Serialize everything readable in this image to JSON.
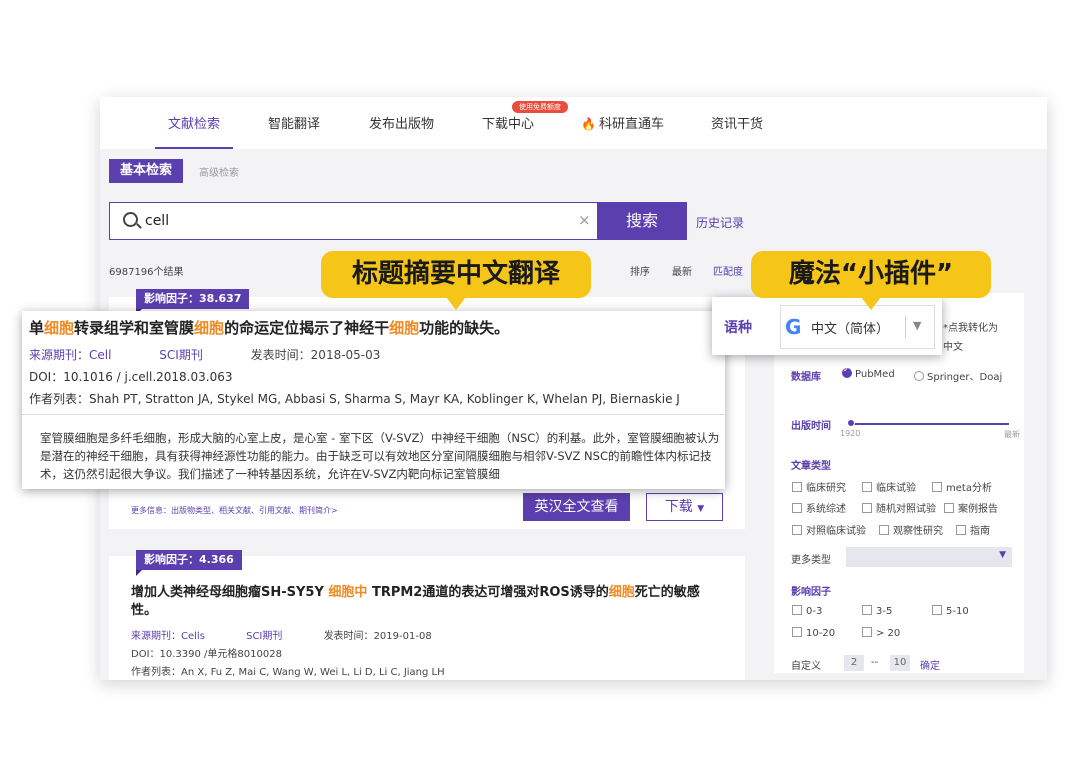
{
  "nav": {
    "items": [
      "文献检索",
      "智能翻译",
      "发布出版物",
      "下载中心",
      "科研直通车",
      "资讯干货"
    ],
    "badge": "使用免费额度"
  },
  "tabs": {
    "basic": "基本检索",
    "advanced": "高级检索"
  },
  "search": {
    "query": "cell",
    "clear": "×",
    "button": "搜索",
    "history": "历史记录"
  },
  "results": {
    "count": "6987196个结果",
    "sort": [
      "排序",
      "最新",
      "匹配度"
    ]
  },
  "callouts": {
    "translate": "标题摘要中文翻译",
    "plugin": "魔法“小插件”"
  },
  "article1": {
    "impact": "影响因子：38.637",
    "title_parts": [
      "单",
      "细胞",
      "转录组学和室管膜",
      "细胞",
      "的命运定位揭示了神经干",
      "细胞",
      "功能的缺失。"
    ],
    "journal_label": "来源期刊：",
    "journal": "Cell",
    "sci": "SCI期刊",
    "date_label": "发表时间：",
    "date": "2018-05-03",
    "doi": "DOI：10.1016 / j.cell.2018.03.063",
    "authors": "作者列表：Shah PT, Stratton JA, Stykel MG, Abbasi S, Sharma S, Mayr KA, Koblinger K, Whelan PJ, Biernaskie J",
    "abstract": "室管膜细胞是多纤毛细胞，形成大脑的心室上皮，是心室 - 室下区（V-SVZ）中神经干细胞（NSC）的利基。此外，室管膜细胞被认为是潜在的神经干细胞，具有获得神经源性功能的能力。由于缺乏可以有效地区分室间隔膜细胞与相邻V-SVZ NSC的前瞻性体内标记技术，这仍然引起很大争议。我们描述了一种转基因系统，允许在V-SVZ内靶向标记室管膜细",
    "more": "更多信息：出版物类型、相关文献、引用文献、期刊简介>",
    "fulltext_btn": "英汉全文查看",
    "download_btn": "下载"
  },
  "article2": {
    "impact": "影响因子：4.366",
    "title_parts": [
      "增加人类神经母细胞瘤SH-SY5Y ",
      "细胞中",
      " TRPM2通道的表达可增强对ROS诱导的",
      "细胞",
      "死亡的敏感性。"
    ],
    "journal_label": "来源期刊：",
    "journal": "Cells",
    "sci": "SCI期刊",
    "date_label": "发表时间：",
    "date": "2019-01-08",
    "doi": "DOI：10.3390 /单元格8010028",
    "authors": "作者列表：An X, Fu Z, Mai C, Wang W, Wei L, Li D, Li C, Jiang LH"
  },
  "plugin": {
    "label": "语种",
    "value": "中文（简体）",
    "note_line1": "*点我转化为",
    "note_line2": "中文"
  },
  "sidebar": {
    "db_label": "数据库",
    "db_options": [
      "PubMed",
      "Springer、Doaj"
    ],
    "pub_time_label": "出版时间",
    "pub_time_min": "1920",
    "pub_time_max": "最新",
    "type_label": "文章类型",
    "types": [
      "临床研究",
      "临床试验",
      "meta分析",
      "系统综述",
      "随机对照试验",
      "案例报告",
      "对照临床试验",
      "观察性研究",
      "指南"
    ],
    "more_types": "更多类型",
    "if_label": "影响因子",
    "if_ranges": [
      "0-3",
      "3-5",
      "5-10",
      "10-20",
      "> 20"
    ],
    "custom_label": "自定义",
    "custom_from": "2",
    "custom_sep": "--",
    "custom_to": "10",
    "confirm": "确定"
  },
  "colors": {
    "accent": "#5b3fae",
    "highlight": "#f08a24",
    "callout": "#f5c518"
  }
}
